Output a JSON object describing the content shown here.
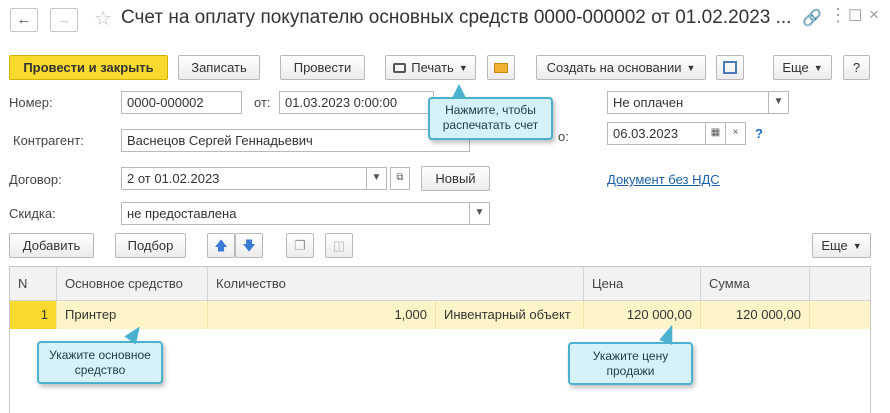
{
  "window": {
    "title": "Счет на оплату покупателю основных средств 0000-000002 от 01.02.2023 ..."
  },
  "toolbar": {
    "post_close": "Провести и закрыть",
    "save": "Записать",
    "post": "Провести",
    "print": "Печать",
    "create_based": "Создать на основании",
    "more": "Еще",
    "help": "?"
  },
  "form": {
    "number_label": "Номер:",
    "number_value": "0000-000002",
    "from_label": "от:",
    "date_value": "01.03.2023  0:00:00",
    "status_value": "Не оплачен",
    "contractor_label": "Контрагент:",
    "contractor_value": "Васнецов Сергей Геннадьевич",
    "due_label_fragment": "о:",
    "due_value": "06.03.2023",
    "help_q": "?",
    "contract_label": "Договор:",
    "contract_value": "2 от 01.02.2023",
    "new_button": "Новый",
    "vat_link": "Документ без НДС",
    "discount_label": "Скидка:",
    "discount_value": "не предоставлена"
  },
  "table_toolbar": {
    "add": "Добавить",
    "pick": "Подбор",
    "more": "Еще"
  },
  "table": {
    "headers": [
      "N",
      "Основное средство",
      "Количество",
      "Цена",
      "Сумма"
    ],
    "rows": [
      {
        "n": "1",
        "asset": "Принтер",
        "qty": "1,000",
        "unit": "Инвентарный объект",
        "price": "120 000,00",
        "sum": "120 000,00"
      }
    ]
  },
  "callouts": {
    "print": "Нажмите, чтобы распечатать счет",
    "asset": "Укажите основное средство",
    "price": "Укажите цену продажи"
  },
  "colors": {
    "primary_button": "#f7da2d",
    "selected_row": "#fdf5c7",
    "callout_bg": "#d6f1f8",
    "callout_border": "#4ab1cf",
    "link": "#1a5fa8"
  }
}
